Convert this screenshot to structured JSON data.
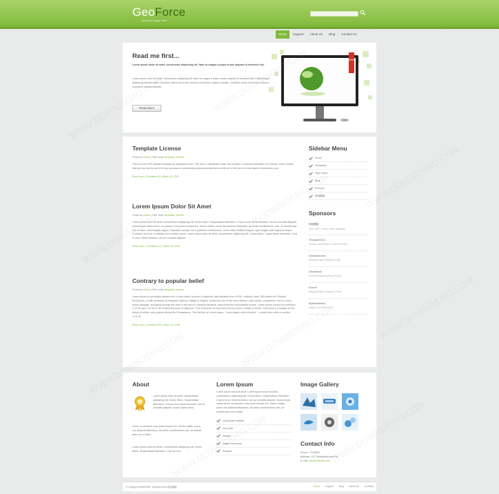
{
  "header": {
    "logo_a": "Geo",
    "logo_b": "Force",
    "tagline": "put your slogan here"
  },
  "nav": [
    {
      "label": "Home"
    },
    {
      "label": "Support"
    },
    {
      "label": "About Us"
    },
    {
      "label": "Blog"
    },
    {
      "label": "Contact Us"
    }
  ],
  "intro": {
    "title": "Read me first...",
    "lead": "Lorem ipsum dolor sit amet, consectetur adipiscing elit. Nam eu magna a turpis ornare aliquam id hendrerit nisl.",
    "body": "Lorem ipsum dolor sit amet, consectetur adipiscing elit. Nam eu magna a turpis ornare aliquam id hendrerit nisl. Pellentesque adipiscing blandit mollis. Curabitur varius est et sem rhoncus et pretium massa molestie. Curabitur varius est et sem rhoncus et pretium massa molestie.",
    "button": "Read More",
    "ribbon": "NEW"
  },
  "articles": [
    {
      "title": "Template License",
      "meta_prefix": "Posted by ",
      "author": "Owner",
      "meta_mid": " | Filed under ",
      "tags": "templates, internet",
      "body": "This is a free CSS website template by downdemo.com. This work is distributed under the Creative Commons Attribution 3.0 License, which means that you are free to use it for any personal or commercial purpose provided you credit me in the form of a link back to downdemo.com.",
      "more": "Read more | Comments (0) | March 16, 2015"
    },
    {
      "title": "Lorem Ipsum Dolor Sit Amet",
      "meta_prefix": "Posted by ",
      "author": "Owner",
      "meta_mid": " | Filed under ",
      "tags": "templates, internet",
      "body": "Lorem ipsum dolor sit amet, consectetuer adipiscing elit. Donec libero. Suspendisse bibendum. Cras id urna. Morbi tincidunt, orci ac convallis aliquam, lectus turpis varius lorem, eu posuere nunc justo tempus leo. Donec mattis, purus nec placerat bibendum, dui pede condimentum odio, ac blandit ante orci ut diam. Cras fringilla magna. Phasellus suscipit, leo a pharetra condimentum, lorem tellus eleifend magna, eget fringilla velit magna id neque. Curabitur vel urna. In tristique orci porttitor ipsum. Lorem ipsum dolor sit amet, consectetuer adipiscing elit. Donec libero. Suspendisse bibendum. Cras id urna. Morbi tincidunt, orci ac convallis aliquam.",
      "more": "Read more | Comments (11) | March 16, 2015"
    },
    {
      "title": "Contrary to popular belief",
      "meta_prefix": "Posted by ",
      "author": "Owner",
      "meta_mid": " | Filed under ",
      "tags": "templates, internet",
      "body": "Lorem Ipsum is not simply random text. It has roots in a piece of classical Latin literature from 45 BC, making it over 2000 years old. Richard McClintock, a Latin professor at Hampden-Sydney College in Virginia, looked up one of the more obscure Latin words, consectetur, from a Lorem Ipsum passage, and going through the cites of the word in classical literature, discovered the undoubtable source. Lorem Ipsum comes from sections 1.10.32 and 1.10.33 of \"de Finibus Bonorum et Malorum\" (The Extremes of Good and Evil) by Cicero, written in 45 BC. This book is a treatise on the theory of ethics, very popular during the Renaissance. The first line of Lorem Ipsum, \"Lorem ipsum dolor sit amet..\", comes from a line in section 1.10.32.",
      "more": "Read more | Comments (50) | March 16, 2015"
    }
  ],
  "sidebar": {
    "title": "Sidebar Menu",
    "items": [
      {
        "label": "Home"
      },
      {
        "label": "Templates"
      },
      {
        "label": "Style Demo"
      },
      {
        "label": "Blog"
      },
      {
        "label": "Archives"
      },
      {
        "label": "网站模板"
      }
    ]
  },
  "sponsors": {
    "title": "Sponsors",
    "items": [
      {
        "name": "网站模板",
        "desc": "Over 1000+ Premium Web Templates"
      },
      {
        "name": "TemplateSOLD",
        "desc": "Premium WordPress & Joomla Themes"
      },
      {
        "name": "Icethosted.com",
        "desc": "Affordable Web Hosting Provider"
      },
      {
        "name": "DreamDock",
        "desc": "Download Amazing Stock Photos"
      },
      {
        "name": "EvrenR",
        "desc": "Website Builder Software & Tools"
      },
      {
        "name": "MyWebsiteAds",
        "desc": "Display Your Stock Here"
      }
    ]
  },
  "about": {
    "title": "About",
    "p1": "Lorem ipsum dolor sit amet, consectetuer adipiscing elit. Donec libero. Suspendisse bibendum. Cras id urna. Morbi tincidunt, orci ac convallis aliquam, lectus turpis varius.",
    "p2": "lorem, eu posuere nunc justo tempus leo. Donec mattis, purus nec placerat bibendum, dui pede condimentum odio, ac blandit ante orci ut diam.",
    "p3": "Lorem ipsum dolor sit amet, consectetuer adipiscing elit. Donec libero. Suspendisse bibendum. Cras id urna."
  },
  "lorem_col": {
    "title": "Lorem Ipsum",
    "body": "Lorem ipsum dolor sit amet. Lorem ipsum dolor sit amet, consectetuer adipiscing elit. Donec libero. Suspendisse bibendum. Cras id urna. Morbi tincidunt, orci ac convallis aliquam, lectus turpis varius lorem, eu posuere nunc justo tempus leo. Donec mattis, purus nec placerat bibendum, dui pede condimentum odio, ac blandit ante orci ut diam.",
    "list": [
      {
        "label": "consequat molestie"
      },
      {
        "label": "sem justo"
      },
      {
        "label": "semper"
      },
      {
        "label": "magna sed purus"
      },
      {
        "label": "tincidunt"
      }
    ]
  },
  "gallery": {
    "title": "Image Gallery"
  },
  "contact": {
    "title": "Contact Info",
    "phone": "Phone: +1234567",
    "address": "Address: 123 TemplateAccess Rd",
    "email_label": "E-mail: ",
    "email": "info@example.com"
  },
  "footer": {
    "copyright": "© Copyright MyWebSite. Designed from 网站模板",
    "links": [
      {
        "label": "Home"
      },
      {
        "label": "Support"
      },
      {
        "label": "Blog"
      },
      {
        "label": "About Us"
      },
      {
        "label": "Contacts"
      }
    ]
  },
  "watermark": "WWW.DOWNDEMO.COM",
  "colors": {
    "accent": "#7fb93a",
    "header": "#a9d46a"
  }
}
